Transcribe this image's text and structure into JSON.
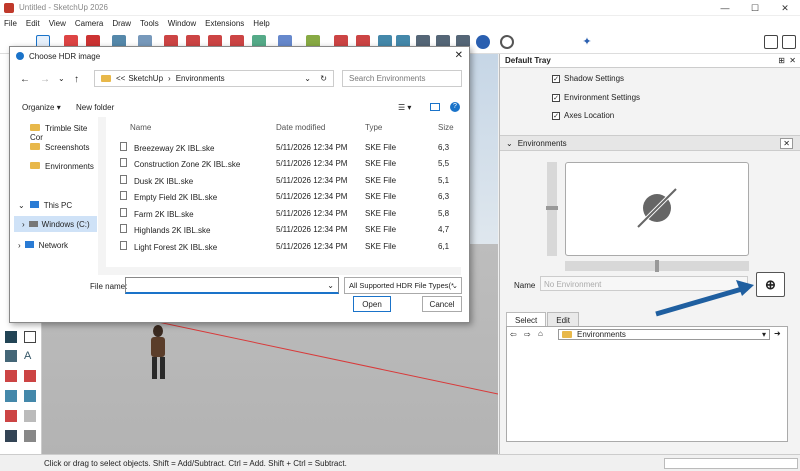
{
  "app": {
    "title": "Untitled - SketchUp 2026"
  },
  "menu": [
    "File",
    "Edit",
    "View",
    "Camera",
    "Draw",
    "Tools",
    "Window",
    "Extensions",
    "Help"
  ],
  "dialog": {
    "title": "Choose HDR image",
    "breadcrumb_root": "SketchUp",
    "breadcrumb_current": "Environments",
    "search_placeholder": "Search Environments",
    "organize": "Organize",
    "new_folder": "New folder",
    "nav_items": [
      {
        "label": "Trimble Site Cor"
      },
      {
        "label": "Screenshots"
      },
      {
        "label": "Environments"
      },
      {
        "label": "This PC"
      },
      {
        "label": "Windows (C:)"
      },
      {
        "label": "Network"
      }
    ],
    "columns": {
      "name": "Name",
      "date": "Date modified",
      "type": "Type",
      "size": "Size"
    },
    "files": [
      {
        "name": "Breezeway 2K IBL.ske",
        "date": "5/11/2026 12:34 PM",
        "type": "SKE File",
        "size": "6,3"
      },
      {
        "name": "Construction Zone 2K IBL.ske",
        "date": "5/11/2026 12:34 PM",
        "type": "SKE File",
        "size": "5,5"
      },
      {
        "name": "Dusk 2K IBL.ske",
        "date": "5/11/2026 12:34 PM",
        "type": "SKE File",
        "size": "5,1"
      },
      {
        "name": "Empty Field 2K IBL.ske",
        "date": "5/11/2026 12:34 PM",
        "type": "SKE File",
        "size": "6,3"
      },
      {
        "name": "Farm 2K IBL.ske",
        "date": "5/11/2026 12:34 PM",
        "type": "SKE File",
        "size": "5,8"
      },
      {
        "name": "Highlands 2K IBL.ske",
        "date": "5/11/2026 12:34 PM",
        "type": "SKE File",
        "size": "4,7"
      },
      {
        "name": "Light Forest 2K IBL.ske",
        "date": "5/11/2026 12:34 PM",
        "type": "SKE File",
        "size": "6,1"
      }
    ],
    "file_name_label": "File name:",
    "file_name_value": "",
    "file_type": "All Supported HDR File Types(*.",
    "open": "Open",
    "cancel": "Cancel"
  },
  "tray": {
    "title": "Default Tray",
    "checkboxes": [
      "Shadow Settings",
      "Environment Settings",
      "Axes Location"
    ],
    "section": "Environments",
    "name_label": "Name",
    "name_placeholder": "No Environment",
    "tabs": [
      "Select",
      "Edit"
    ],
    "dropdown": "Environments"
  },
  "status": {
    "text": "Click or drag to select objects. Shift = Add/Subtract. Ctrl = Add. Shift + Ctrl = Subtract."
  },
  "colors": {
    "accent": "#1a73c9",
    "arrow": "#1f5fa0",
    "grid_red": "#d83a3a",
    "grid_green": "#3aa04a"
  }
}
